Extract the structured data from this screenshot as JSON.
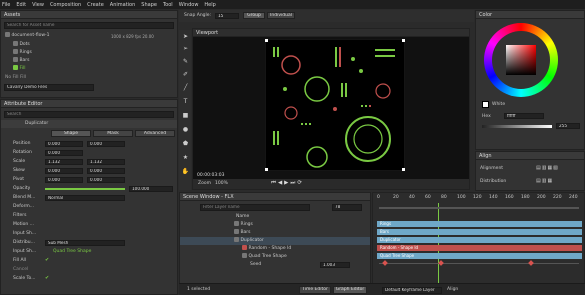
{
  "menu": [
    "File",
    "Edit",
    "View",
    "Composition",
    "Create",
    "Animation",
    "Shape",
    "Tool",
    "Window",
    "Help"
  ],
  "assets": {
    "title": "Assets",
    "search_placeholder": "Search for Asset name",
    "items": [
      "document-flow-1",
      "Dots",
      "Rings",
      "Bars",
      "Fill"
    ],
    "doc_size": "1000 x 829",
    "doc_fps": "fps",
    "doc_dur": "20.00",
    "no_fill": "No Fill Fill",
    "canvas_fonts": "Cavalry Demo Files"
  },
  "attribute_editor": {
    "title": "Attribute Editor",
    "search_placeholder": "Search",
    "layer": "Duplicator",
    "tabs": [
      "Shape",
      "Mask",
      "Advanced"
    ],
    "rows": [
      {
        "label": "Position",
        "v1": "0.000",
        "v2": "0.000"
      },
      {
        "label": "Rotation",
        "v1": "0.000",
        "v2": ""
      },
      {
        "label": "Scale",
        "v1": "1.132",
        "v2": "1.132"
      },
      {
        "label": "Skew",
        "v1": "0.000",
        "v2": "0.000"
      },
      {
        "label": "Pivot",
        "v1": "0.000",
        "v2": "0.000"
      },
      {
        "label": "Opacity",
        "v1": "",
        "v2": "100.000"
      },
      {
        "label": "Blend M...",
        "v1": "Normal",
        "v2": ""
      },
      {
        "label": "Deform...",
        "v1": "",
        "v2": ""
      },
      {
        "label": "Filters",
        "v1": "",
        "v2": ""
      },
      {
        "label": "Motion ...",
        "v1": "",
        "v2": ""
      },
      {
        "label": "Input Sh...",
        "v1": "",
        "v2": ""
      },
      {
        "label": "Distribu...",
        "v1": "Sub Mesh",
        "v2": ""
      },
      {
        "label": "Input Sh...",
        "v1": "Quad Tree Shape",
        "v2": ""
      },
      {
        "label": "Fill All",
        "v1": "",
        "v2": ""
      },
      {
        "label": "Cancel",
        "v1": "",
        "v2": ""
      },
      {
        "label": "Scale To...",
        "v1": "",
        "v2": ""
      }
    ]
  },
  "toolbar": {
    "snap_label": "Snap Angle:",
    "snap_value": "15",
    "group_label": "Group",
    "individual_label": "Individual"
  },
  "viewport": {
    "title": "Viewport",
    "timecode": "00:00:03:03",
    "zoom_label": "Zoom",
    "zoom_value": "100%"
  },
  "scene": {
    "title": "Scene Window - FLX",
    "search_placeholder": "Filter Layer name",
    "frame_value": "78",
    "name_header": "Name",
    "layers": [
      "Rings",
      "Bars",
      "Duplicator",
      "Random - Shape Id",
      "Quad Tree Shape"
    ],
    "seed_label": "Seed",
    "seed_value": "1.003"
  },
  "timeline": {
    "ruler": [
      "0",
      "20",
      "40",
      "60",
      "80",
      "100",
      "120",
      "140",
      "160",
      "180",
      "200",
      "220",
      "240"
    ],
    "bars": [
      "Rings",
      "Bars",
      "Duplicator",
      "Random - Shape Id",
      "Quad Tree Shape"
    ]
  },
  "status": {
    "selected": "1 selected",
    "time_editor": "Time Editor",
    "graph_editor": "Graph Editor",
    "keyframe_layer": "Default Keyframe Layer",
    "align": "Align"
  },
  "color_panel": {
    "title": "Color",
    "white_label": "White",
    "hex_label": "Hex",
    "hex_value": "ffffff",
    "alpha_value": "255"
  },
  "align_panel": {
    "title": "Align",
    "alignment_label": "Alignment",
    "distribution_label": "Distribution"
  },
  "colors": {
    "accent_green": "#7ac943",
    "timeline_blue": "#6fa8c8",
    "timeline_red": "#c0504d",
    "key_red": "#d9534f"
  }
}
